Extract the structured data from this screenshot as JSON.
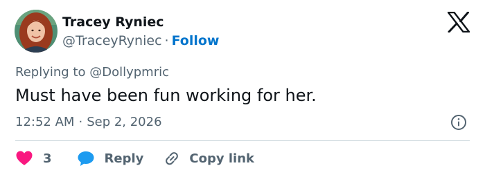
{
  "author": {
    "name": "Tracey Ryniec",
    "handle": "@TraceyRyniec",
    "separator": "·",
    "follow_label": "Follow",
    "avatar_icon": "profile-photo"
  },
  "brand_icon": "x-logo",
  "reply_context": {
    "prefix": "Replying to",
    "mention": "@Dollypmric"
  },
  "tweet": {
    "text": "Must have been fun working for her."
  },
  "meta": {
    "time": "12:52 AM",
    "separator": "·",
    "date": "Sep 2, 2026",
    "info_icon": "info-icon"
  },
  "actions": {
    "like_count": "3",
    "reply_label": "Reply",
    "copy_label": "Copy link"
  },
  "colors": {
    "link_blue": "#0074cc",
    "like_pink": "#f91880",
    "reply_blue": "#1d9bf0",
    "muted_text": "#536471",
    "primary_text": "#0f1419"
  }
}
